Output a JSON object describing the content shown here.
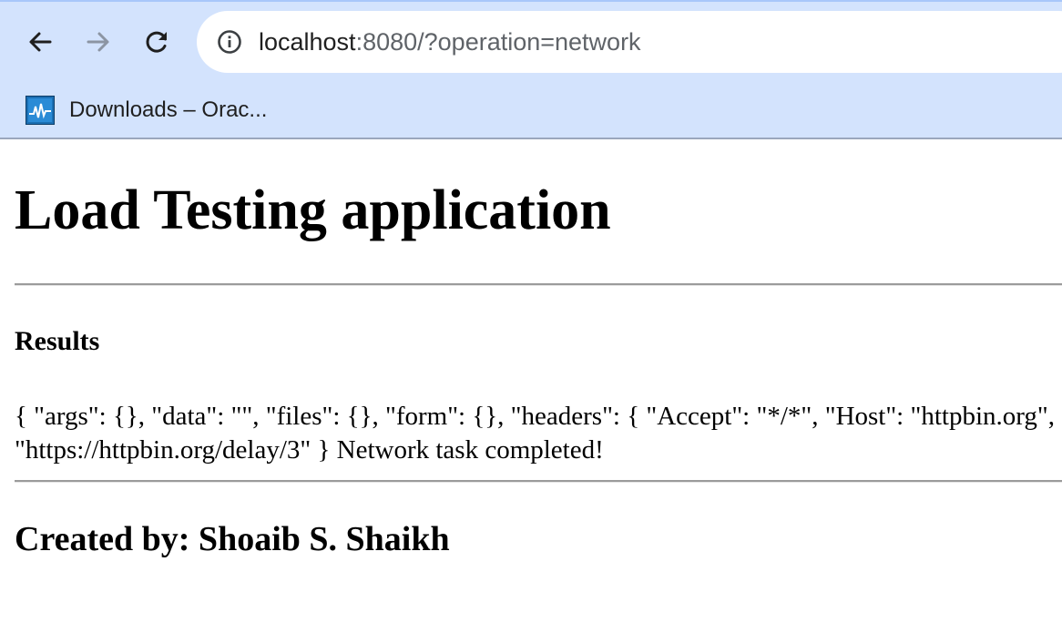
{
  "browser": {
    "url_host": "localhost",
    "url_rest": ":8080/?operation=network",
    "bookmarks": [
      {
        "label": "Downloads – Orac...",
        "icon": "oracle-favicon-icon"
      }
    ],
    "nav": {
      "back_icon": "back-arrow-icon",
      "forward_icon": "forward-arrow-icon",
      "reload_icon": "reload-icon",
      "info_icon": "info-icon"
    },
    "colors": {
      "chrome_bg": "#d3e3fd",
      "omnibox_bg": "#ffffff",
      "forward_disabled": "#8c95a3"
    }
  },
  "page": {
    "title": "Load Testing application",
    "results_heading": "Results",
    "result_line_1": "{ \"args\": {}, \"data\": \"\", \"files\": {}, \"form\": {}, \"headers\": { \"Accept\": \"*/*\", \"Host\": \"httpbin.org\",",
    "result_line_2": "\"https://httpbin.org/delay/3\" } Network task completed!",
    "credits": "Created by: Shoaib S. Shaikh"
  }
}
